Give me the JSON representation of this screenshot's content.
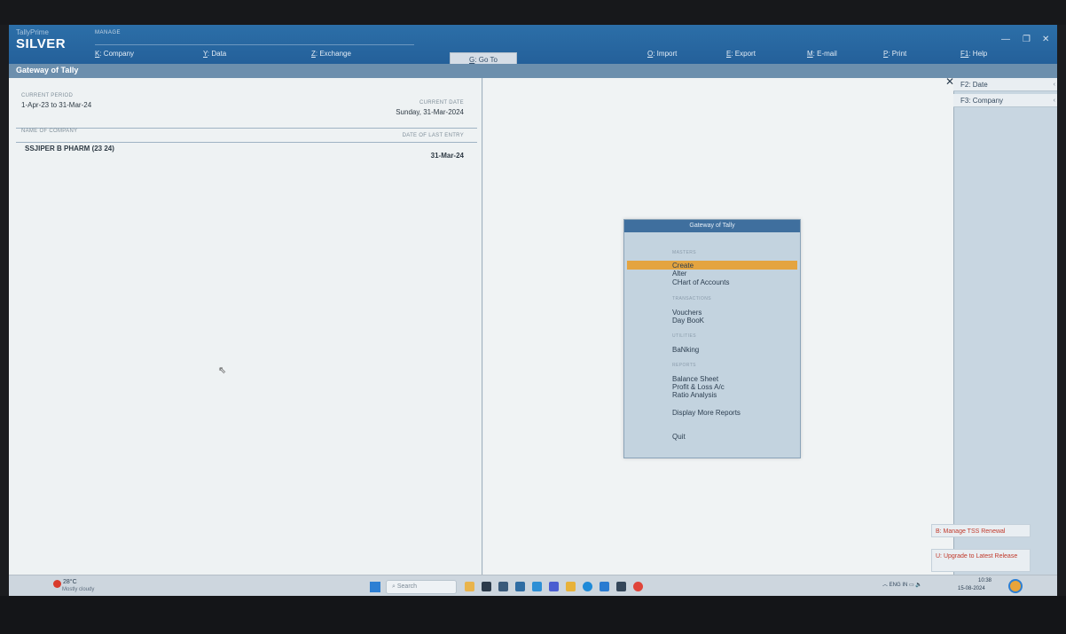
{
  "app": {
    "brand_small": "TallyPrime",
    "brand_big": "SILVER",
    "manage_label": "MANAGE"
  },
  "menu": {
    "company": {
      "key": "K",
      "rest": ": Company"
    },
    "data": {
      "key": "Y",
      "rest": ": Data"
    },
    "exchange": {
      "key": "Z",
      "rest": ": Exchange"
    },
    "goto": {
      "key": "G",
      "rest": ": Go To"
    },
    "import": {
      "key": "O",
      "rest": ": Import"
    },
    "export": {
      "key": "E",
      "rest": ": Export"
    },
    "email": {
      "key": "M",
      "rest": ": E-mail"
    },
    "print": {
      "key": "P",
      "rest": ": Print"
    },
    "help": {
      "key": "F1",
      "rest": ": Help"
    }
  },
  "title": "Gateway of Tally",
  "left": {
    "period_label": "CURRENT PERIOD",
    "period_value": "1-Apr-23 to 31-Mar-24",
    "date_label": "CURRENT DATE",
    "date_value": "Sunday, 31-Mar-2024",
    "company_label": "NAME OF COMPANY",
    "last_entry_label": "DATE OF LAST ENTRY",
    "company_name": "SSJIPER B PHARM (23 24)",
    "last_entry_value": "31-Mar-24"
  },
  "gateway": {
    "header": "Gateway of Tally",
    "sections": {
      "masters": "MASTERS",
      "transactions": "TRANSACTIONS",
      "utilities": "UTILITIES",
      "reports": "REPORTS"
    },
    "items": {
      "create": "Create",
      "alter": "Alter",
      "chart": "CHart of Accounts",
      "vouchers": "Vouchers",
      "daybook": "Day BooK",
      "banking": "BaNking",
      "balance_sheet": "Balance Sheet",
      "profit_loss": "Profit & Loss A/c",
      "ratio": "Ratio Analysis",
      "more_reports": "Display More Reports",
      "quit": "Quit"
    }
  },
  "sidebar": {
    "f2": "F2: Date",
    "f3": "F3: Company",
    "tss": "B: Manage TSS Renewal",
    "upgrade": "U: Upgrade to Latest Release"
  },
  "taskbar": {
    "temp": "28°C",
    "weather": "Mostly cloudy",
    "search": "Search",
    "lang": "ENG",
    "lang_region": "IN",
    "time": "10:38",
    "date": "15-08-2024"
  },
  "colors": {
    "topbar": "#2c6fa8",
    "selection": "#e4a440",
    "panel": "#c3d3df"
  }
}
